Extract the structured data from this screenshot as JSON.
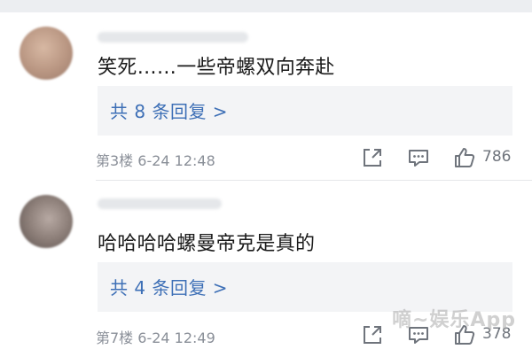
{
  "comments": [
    {
      "text": "笑死……一些帝螺双向奔赴",
      "reply_label": "共 8 条回复 >",
      "meta": "第3楼 6-24 12:48",
      "likes": "786"
    },
    {
      "text": "哈哈哈哈螺曼帝克是真的",
      "reply_label": "共 4 条回复 >",
      "meta": "第7楼 6-24 12:49",
      "likes": "378"
    }
  ],
  "icons": {
    "share": "share-icon",
    "comment": "comment-icon",
    "like": "thumbs-up-icon"
  },
  "colors": {
    "link": "#3d6fb6",
    "meta": "#8a8f98",
    "reply_bg": "#f3f4f6"
  },
  "watermark": "嘀~娱乐App"
}
